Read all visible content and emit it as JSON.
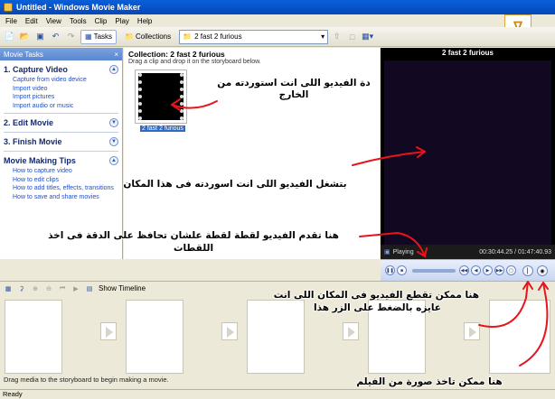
{
  "window": {
    "title": "Untitled - Windows Movie Maker"
  },
  "menu": [
    "File",
    "Edit",
    "View",
    "Tools",
    "Clip",
    "Play",
    "Help"
  ],
  "toolbar": {
    "tasks_label": "Tasks",
    "collections_label": "Collections",
    "collection_select": "2 fast 2 furious"
  },
  "taskpane": {
    "header": "Movie Tasks",
    "close": "×",
    "sections": [
      {
        "title": "1. Capture Video",
        "links": [
          "Capture from video device",
          "Import video",
          "Import pictures",
          "Import audio or music"
        ]
      },
      {
        "title": "2. Edit Movie",
        "links": []
      },
      {
        "title": "3. Finish Movie",
        "links": []
      },
      {
        "title": "Movie Making Tips",
        "links": [
          "How to capture video",
          "How to edit clips",
          "How to add titles, effects, transitions",
          "How to save and share movies"
        ]
      }
    ]
  },
  "collection": {
    "title": "Collection: 2 fast 2 furious",
    "subtitle": "Drag a clip and drop it on the storyboard below.",
    "clip_label": "2 fast 2 furious"
  },
  "preview": {
    "title": "2 fast 2 furious",
    "status": "Playing",
    "time": "00:30:44.25 / 01:47:40.93"
  },
  "storyboard": {
    "show_timeline": "Show Timeline",
    "hint": "Drag media to the storyboard to begin making a movie."
  },
  "statusbar": {
    "text": "Ready"
  },
  "annotations": {
    "clip_note_line1": "دة الفيديو اللى انت استوردته من",
    "clip_note_line2": "الخارج",
    "preview_note": "بتشغل الفيديو اللى انت اسوردته فى هذا المكان",
    "frame_note_line1": "هنا تقدم الفيديو لقطة لقطة علشان تحافظ على الدقة فى اخذ",
    "frame_note_line2": "اللقطات",
    "split_note_line1": "هنا ممكن تقطع الفيديو فى المكان اللى انت",
    "split_note_line2": "عايزه بالضغط على الزر هذا",
    "snapshot_note": "هنا ممكن تاخذ صورة من الفيلم"
  },
  "colors": {
    "annotation_red": "#e8141c",
    "titlebar_blue": "#0a5fd8"
  }
}
